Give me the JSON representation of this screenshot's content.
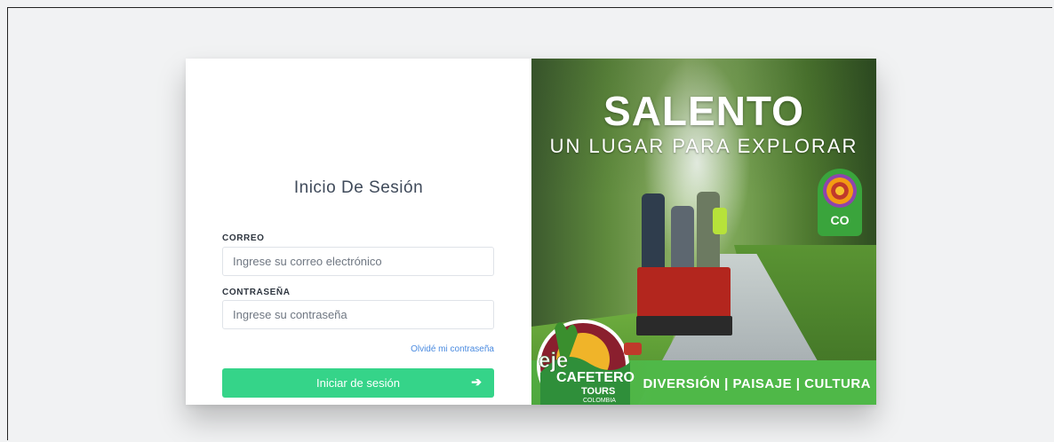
{
  "login": {
    "title": "Inicio De Sesión",
    "email_label": "CORREO",
    "email_placeholder": "Ingrese su correo electrónico",
    "email_value": "",
    "password_label": "CONTRASEÑA",
    "password_placeholder": "Ingrese su contraseña",
    "password_value": "",
    "forgot_link": "Olvidé mi contraseña",
    "submit_label": "Iniciar de sesión",
    "submit_icon": "arrow-right-icon",
    "accent_color": "#35d489"
  },
  "hero": {
    "title": "SALENTO",
    "subtitle": "UN LUGAR PARA EXPLORAR",
    "badge_text": "CO",
    "banner_text": "DIVERSIÓN | PAISAJE | CULTURA",
    "logo_words": [
      "eje",
      "CAFETERO",
      "TOURS",
      "COLOMBIA"
    ]
  }
}
